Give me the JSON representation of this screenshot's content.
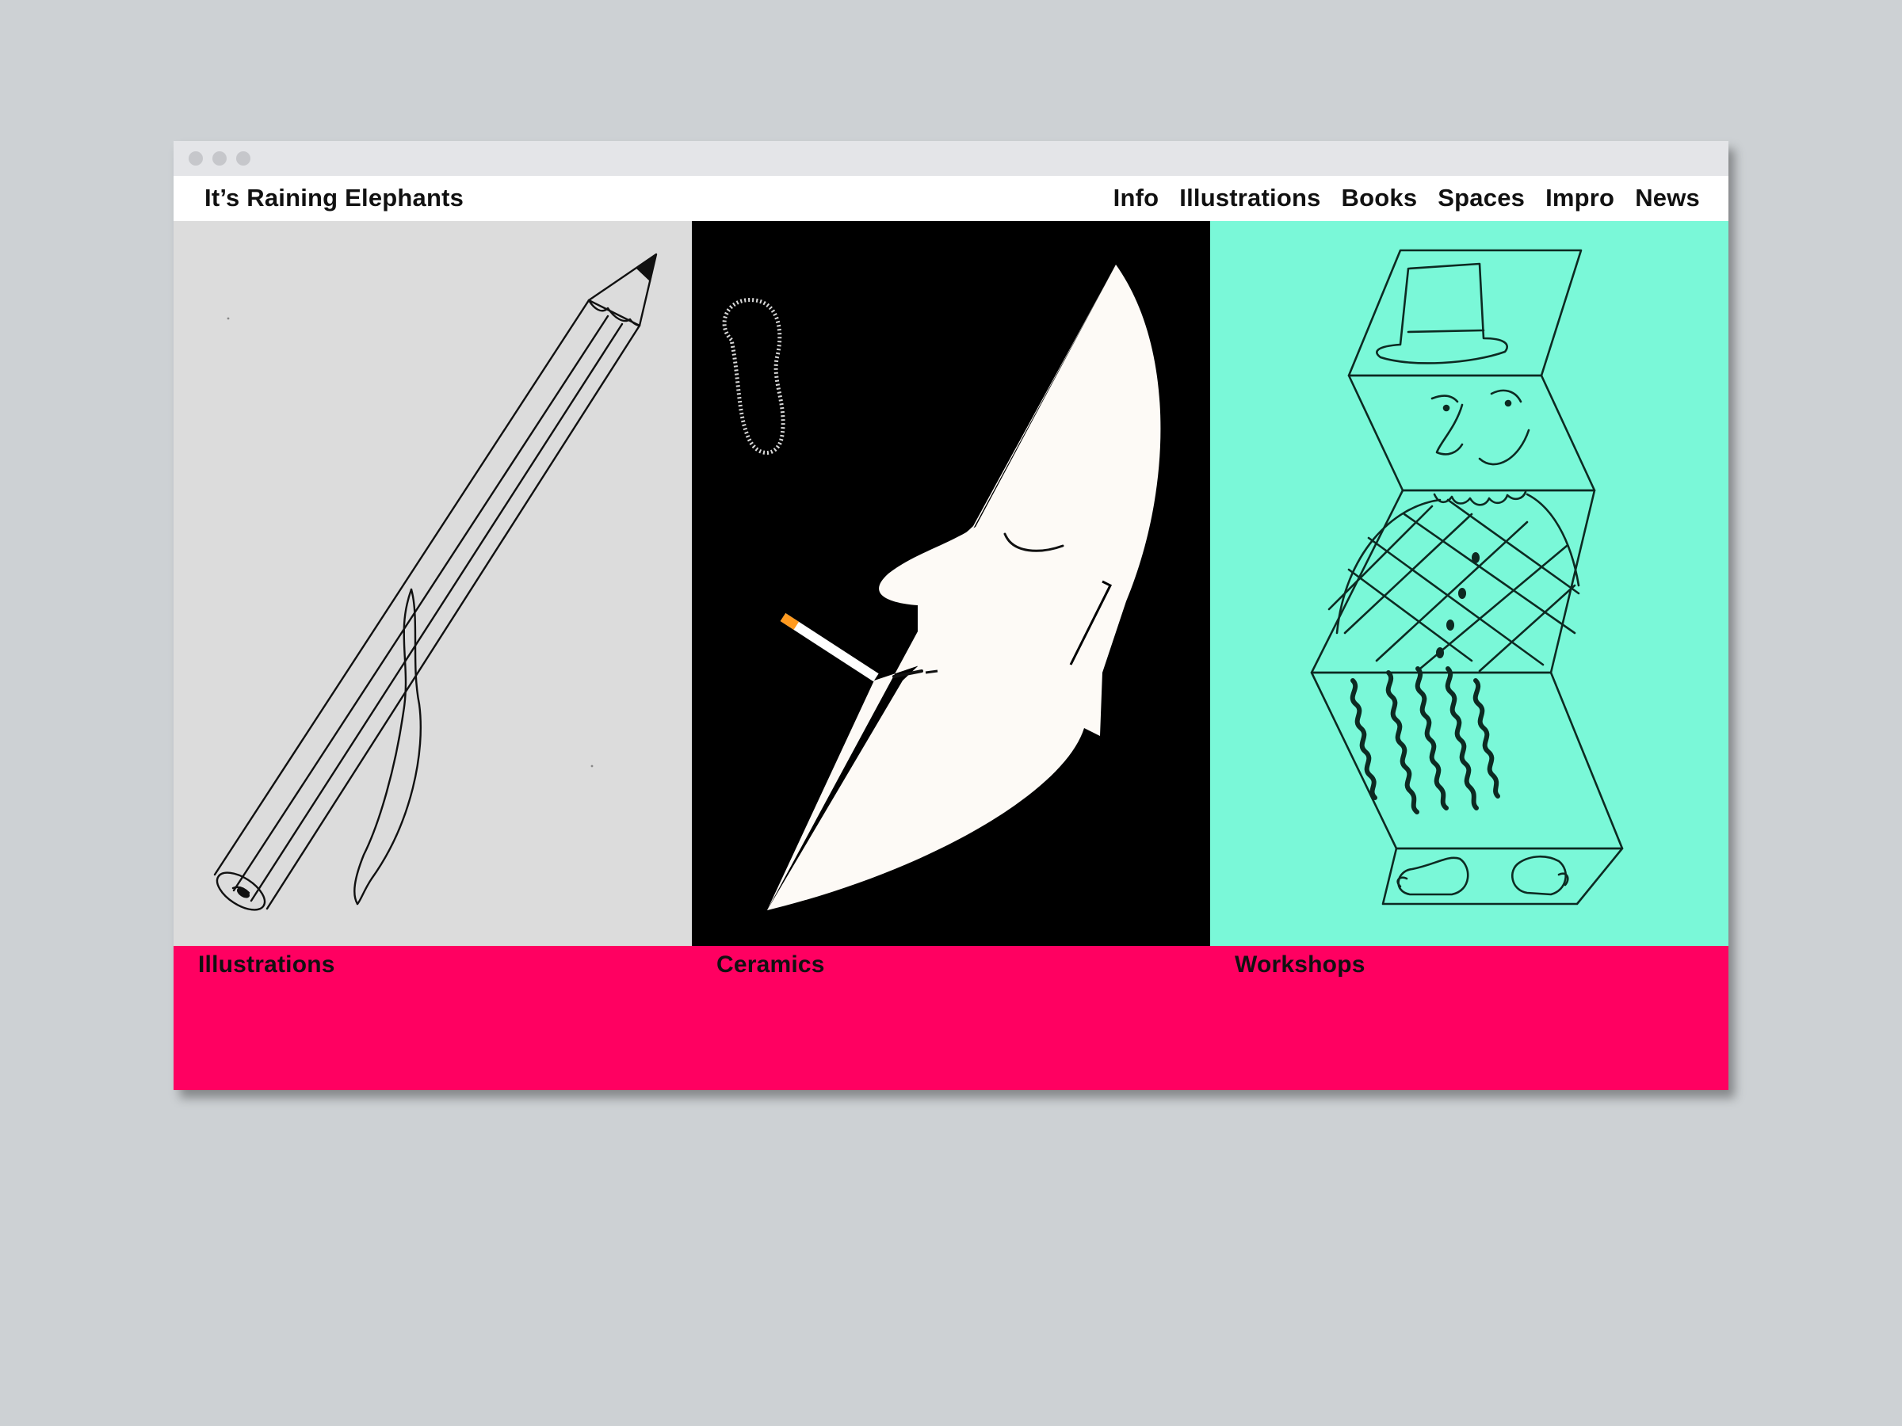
{
  "site": {
    "title": "It’s Raining Elephants"
  },
  "nav": {
    "items": [
      "Info",
      "Illustrations",
      "Books",
      "Spaces",
      "Impro",
      "News"
    ]
  },
  "sections": [
    {
      "label": "Illustrations",
      "background": "#dcdcdc",
      "image": "pencil-illustration"
    },
    {
      "label": "Ceramics",
      "background": "#000000",
      "image": "moon-face-smoking-illustration"
    },
    {
      "label": "Workshops",
      "background": "#7af8d8",
      "image": "folded-zigzag-figure-illustration"
    }
  ],
  "colors": {
    "page_background": "#cdd1d4",
    "footer_band": "#ff0061",
    "text": "#111111"
  }
}
